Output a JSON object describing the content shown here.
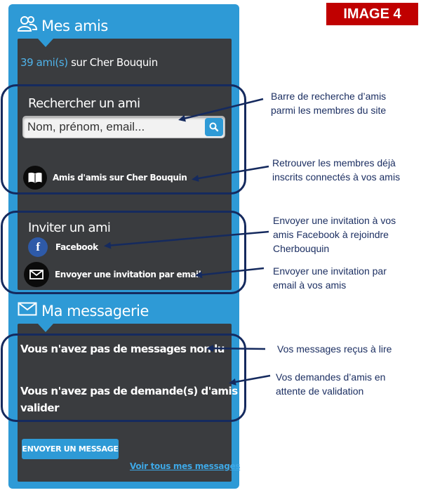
{
  "image_tag": "IMAGE 4",
  "friends": {
    "header_title": "Mes amis",
    "count": "39 ami(s)",
    "count_suffix": "sur Cher Bouquin",
    "search": {
      "title": "Rechercher un ami",
      "placeholder": "Nom, prénom, email..."
    },
    "friends_of_friends_label": "Amis d'amis sur Cher Bouquin",
    "invite": {
      "title": "Inviter un ami",
      "facebook_label": "Facebook",
      "email_label": "Envoyer une invitation par email"
    }
  },
  "messaging": {
    "header_title": "Ma messagerie",
    "no_unread": "Vous n'avez pas de messages non lu",
    "no_requests_line1": "Vous n'avez pas de demande(s) d'amis à",
    "no_requests_line2": "valider",
    "send_button": "ENVOYER UN MESSAGE",
    "see_all_link": "Voir tous mes messages"
  },
  "annotations": {
    "search": [
      "Barre de recherche d’amis",
      "parmi les membres du site"
    ],
    "friends_of_friends": [
      "Retrouver les membres déjà",
      "inscrits connectés à vos amis"
    ],
    "facebook": [
      "Envoyer une invitation à vos",
      "amis Facebook à rejoindre",
      "Cherbouquin"
    ],
    "email": [
      "Envoyer une invitation par",
      "email à vos amis"
    ],
    "messages": [
      "Vos messages reçus à lire"
    ],
    "requests": [
      "Vos demandes d’amis en",
      "attente de validation"
    ]
  },
  "colors": {
    "widget_blue": "#2e9ad6",
    "panel_dark": "#3a3c3f",
    "annotation_navy": "#152a5e",
    "tag_red": "#c00000"
  }
}
